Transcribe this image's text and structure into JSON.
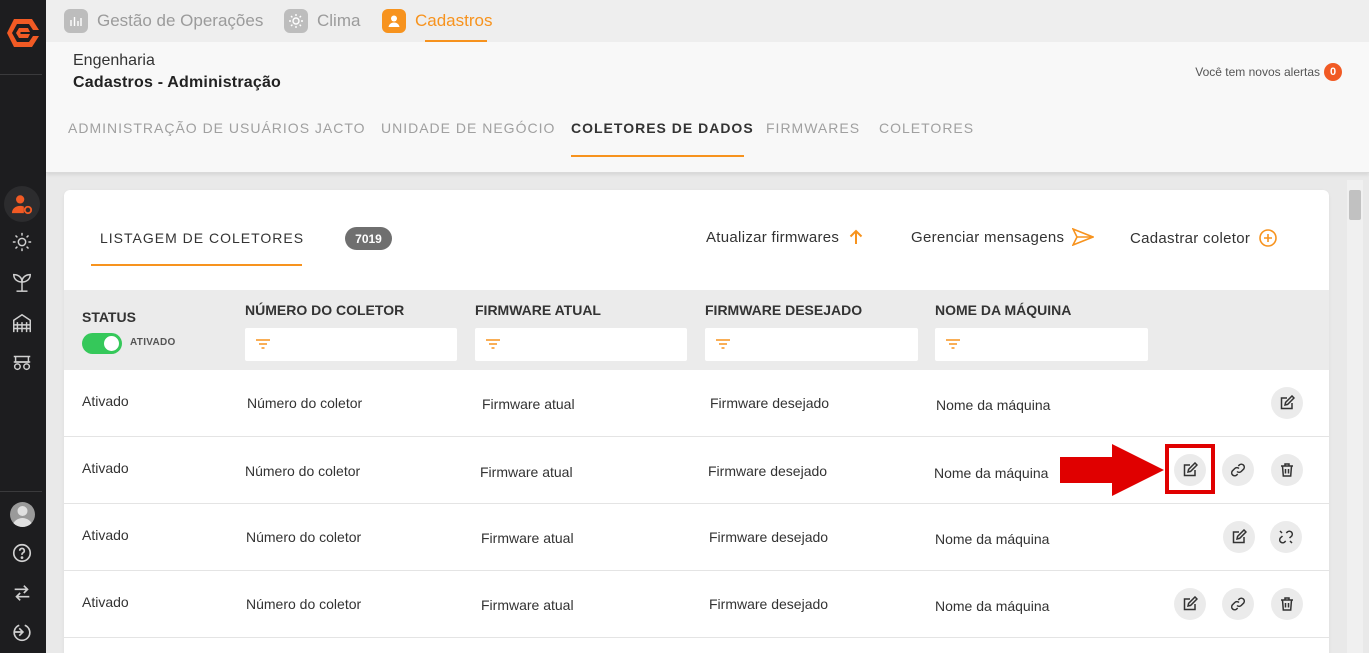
{
  "app_tabs": [
    {
      "label": "Gestão de Operações",
      "icon": "chart-icon",
      "active": false
    },
    {
      "label": "Clima",
      "icon": "sun-icon",
      "active": false
    },
    {
      "label": "Cadastros",
      "icon": "user-icon",
      "active": true
    }
  ],
  "breadcrumb": {
    "area": "Engenharia",
    "page": "Cadastros - Administração"
  },
  "alerts": {
    "text": "Você tem novos alertas",
    "count": "0"
  },
  "sub_tabs": [
    {
      "label": "ADMINISTRAÇÃO DE USUÁRIOS JACTO",
      "active": false
    },
    {
      "label": "UNIDADE DE NEGÓCIO",
      "active": false
    },
    {
      "label": "COLETORES DE DADOS",
      "active": true
    },
    {
      "label": "FIRMWARES",
      "active": false
    },
    {
      "label": "COLETORES",
      "active": false
    }
  ],
  "listing": {
    "title": "LISTAGEM DE COLETORES",
    "count": "7019",
    "actions": [
      {
        "label": "Atualizar firmwares",
        "icon": "arrow-up-icon"
      },
      {
        "label": "Gerenciar mensagens",
        "icon": "send-icon"
      },
      {
        "label": "Cadastrar coletor",
        "icon": "plus-circle-icon"
      }
    ]
  },
  "table": {
    "columns": {
      "status": "STATUS",
      "status_toggle": "ATIVADO",
      "numero": "NÚMERO DO COLETOR",
      "firmware_atual": "FIRMWARE ATUAL",
      "firmware_desejado": "FIRMWARE DESEJADO",
      "nome_maquina": "NOME DA MÁQUINA"
    },
    "rows": [
      {
        "status": "Ativado",
        "numero": "Número do coletor",
        "firmware_atual": "Firmware atual",
        "firmware_desejado": "Firmware desejado",
        "nome_maquina": "Nome da máquina",
        "actions": [
          "edit-icon"
        ]
      },
      {
        "status": "Ativado",
        "numero": "Número do coletor",
        "firmware_atual": "Firmware atual",
        "firmware_desejado": "Firmware desejado",
        "nome_maquina": "Nome da máquina",
        "actions": [
          "edit-icon",
          "link-icon",
          "trash-icon"
        ]
      },
      {
        "status": "Ativado",
        "numero": "Número do coletor",
        "firmware_atual": "Firmware atual",
        "firmware_desejado": "Firmware desejado",
        "nome_maquina": "Nome da máquina",
        "actions": [
          "edit-icon",
          "unlink-icon"
        ]
      },
      {
        "status": "Ativado",
        "numero": "Número do coletor",
        "firmware_atual": "Firmware atual",
        "firmware_desejado": "Firmware desejado",
        "nome_maquina": "Nome da máquina",
        "actions": [
          "edit-icon",
          "link-icon",
          "trash-icon"
        ]
      }
    ]
  },
  "colors": {
    "accent": "#f7931e",
    "toggle_on": "#35c85a",
    "annotation": "#e00000",
    "sidebar": "#1d1d1f"
  }
}
